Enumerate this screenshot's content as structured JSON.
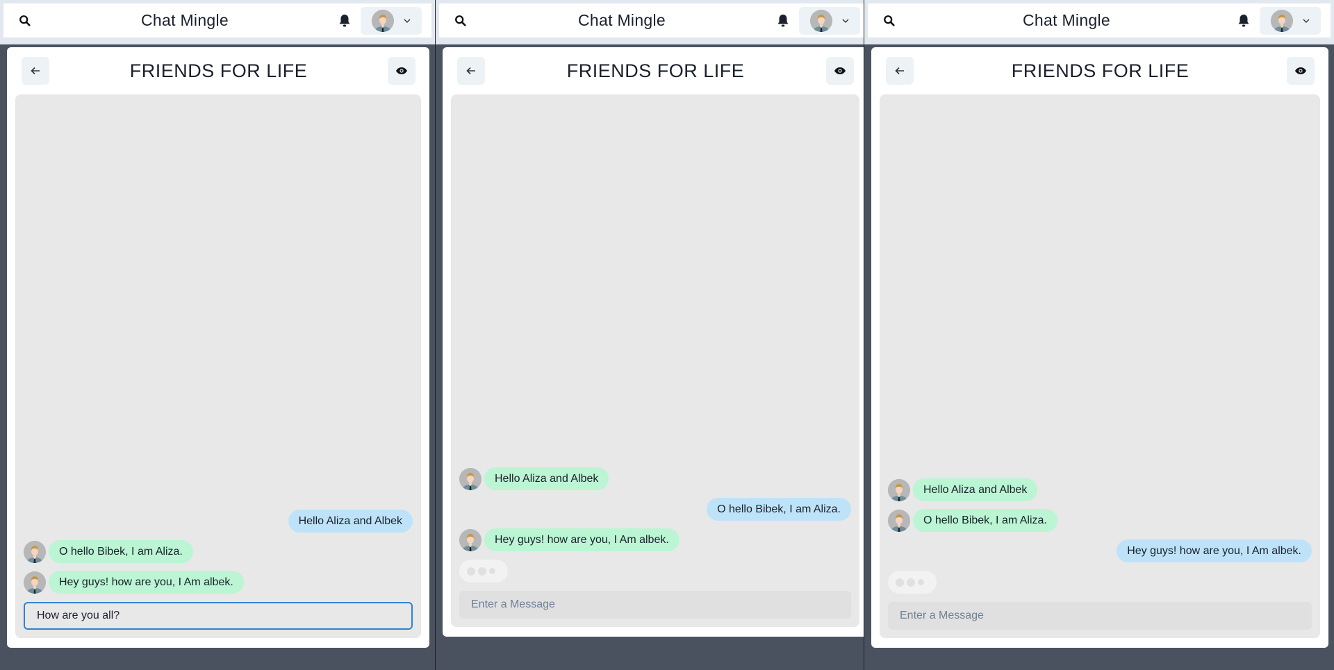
{
  "app_title": "Chat Mingle",
  "chat_title": "FRIENDS FOR LIFE",
  "input_placeholder": "Enter a Message",
  "colors": {
    "received_bubble": "#bbf5d3",
    "sent_bubble": "#bee3f8",
    "focus_border": "#3182ce"
  },
  "icons": {
    "search": "search-icon",
    "bell": "bell-icon",
    "chevron": "chevron-down-icon",
    "back": "arrow-left-icon",
    "view": "eye-icon"
  },
  "panels": [
    {
      "messages": [
        {
          "text": "Hello Aliza and Albek",
          "side": "sent"
        },
        {
          "text": "O hello Bibek, I am Aliza.",
          "side": "received"
        },
        {
          "text": "Hey guys! how are you, I Am albek.",
          "side": "received"
        }
      ],
      "typing": false,
      "input_value": "How are you all?"
    },
    {
      "messages": [
        {
          "text": "Hello Aliza and Albek",
          "side": "received"
        },
        {
          "text": "O hello Bibek, I am Aliza.",
          "side": "sent"
        },
        {
          "text": "Hey guys! how are you, I Am albek.",
          "side": "received"
        }
      ],
      "typing": true,
      "input_value": ""
    },
    {
      "messages": [
        {
          "text": "Hello Aliza and Albek",
          "side": "received"
        },
        {
          "text": "O hello Bibek, I am Aliza.",
          "side": "received"
        },
        {
          "text": "Hey guys! how are you, I Am albek.",
          "side": "sent"
        }
      ],
      "typing": true,
      "input_value": ""
    }
  ]
}
